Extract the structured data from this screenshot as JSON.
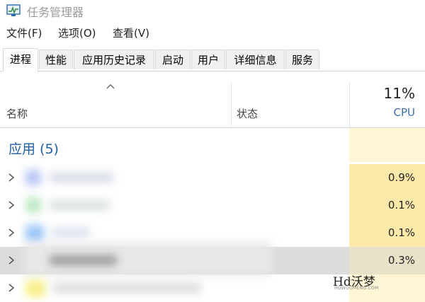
{
  "window": {
    "title": "任务管理器",
    "icon": "task-manager-icon"
  },
  "menu": [
    "文件(F)",
    "选项(O)",
    "查看(V)"
  ],
  "tabs": [
    {
      "label": "进程",
      "active": true
    },
    {
      "label": "性能",
      "active": false
    },
    {
      "label": "应用历史记录",
      "active": false
    },
    {
      "label": "启动",
      "active": false
    },
    {
      "label": "用户",
      "active": false
    },
    {
      "label": "详细信息",
      "active": false
    },
    {
      "label": "服务",
      "active": false
    }
  ],
  "columns": {
    "name": "名称",
    "status": "状态",
    "cpu_total": "11%",
    "cpu_label": "CPU"
  },
  "group": {
    "title": "应用 (5)"
  },
  "rows": [
    {
      "cpu": "0.9%",
      "redacted": true
    },
    {
      "cpu": "0.1%",
      "redacted": true
    },
    {
      "cpu": "0.1%",
      "redacted": true
    },
    {
      "cpu": "0.3%",
      "redacted": true,
      "selected": true
    },
    {
      "cpu": "",
      "redacted": true
    }
  ],
  "watermark": {
    "brand": "Hd沃梦",
    "url": "HDWOOMENG.COM"
  },
  "colors": {
    "accent_blue": "#1f5fa8",
    "cpu_header_blue": "#3c6fb0",
    "cpu_cell_high": "#fde9a9",
    "cpu_cell_low": "#fff4d6",
    "selected_row": "#d9d9d9"
  }
}
